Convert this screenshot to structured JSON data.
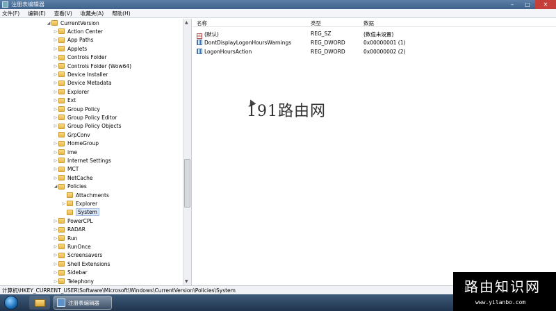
{
  "window": {
    "title": "注册表编辑器",
    "minimize": "–",
    "maximize": "□",
    "close": "✕"
  },
  "menu": [
    "文件(F)",
    "编辑(E)",
    "查看(V)",
    "收藏夹(A)",
    "帮助(H)"
  ],
  "tree": {
    "root": "CurrentVersion",
    "items": [
      {
        "label": "Action Center",
        "level": 1,
        "expander": "▷"
      },
      {
        "label": "App Paths",
        "level": 1,
        "expander": "▷"
      },
      {
        "label": "Applets",
        "level": 1,
        "expander": "▷"
      },
      {
        "label": "Controls Folder",
        "level": 1,
        "expander": "▷"
      },
      {
        "label": "Controls Folder (Wow64)",
        "level": 1,
        "expander": "▷"
      },
      {
        "label": "Device Installer",
        "level": 1,
        "expander": "▷"
      },
      {
        "label": "Device Metadata",
        "level": 1,
        "expander": "▷"
      },
      {
        "label": "Explorer",
        "level": 1,
        "expander": "▷"
      },
      {
        "label": "Ext",
        "level": 1,
        "expander": "▷"
      },
      {
        "label": "Group Policy",
        "level": 1,
        "expander": "▷"
      },
      {
        "label": "Group Policy Editor",
        "level": 1,
        "expander": "▷"
      },
      {
        "label": "Group Policy Objects",
        "level": 1,
        "expander": "▷"
      },
      {
        "label": "GrpConv",
        "level": 1,
        "expander": ""
      },
      {
        "label": "HomeGroup",
        "level": 1,
        "expander": "▷"
      },
      {
        "label": "ime",
        "level": 1,
        "expander": "▷"
      },
      {
        "label": "Internet Settings",
        "level": 1,
        "expander": "▷"
      },
      {
        "label": "MCT",
        "level": 1,
        "expander": "▷"
      },
      {
        "label": "NetCache",
        "level": 1,
        "expander": "▷"
      },
      {
        "label": "Policies",
        "level": 1,
        "expander": "◢"
      },
      {
        "label": "Attachments",
        "level": 2,
        "expander": ""
      },
      {
        "label": "Explorer",
        "level": 2,
        "expander": "▷"
      },
      {
        "label": "System",
        "level": 2,
        "expander": "",
        "selected": true
      },
      {
        "label": "PowerCPL",
        "level": 1,
        "expander": "▷"
      },
      {
        "label": "RADAR",
        "level": 1,
        "expander": "▷"
      },
      {
        "label": "Run",
        "level": 1,
        "expander": "▷"
      },
      {
        "label": "RunOnce",
        "level": 1,
        "expander": "▷"
      },
      {
        "label": "Screensavers",
        "level": 1,
        "expander": "▷"
      },
      {
        "label": "Shell Extensions",
        "level": 1,
        "expander": "▷"
      },
      {
        "label": "Sidebar",
        "level": 1,
        "expander": "▷"
      },
      {
        "label": "Telephony",
        "level": 1,
        "expander": "▷"
      }
    ]
  },
  "list": {
    "headers": {
      "name": "名称",
      "type": "类型",
      "data": "数据"
    },
    "rows": [
      {
        "icon": "string-value-icon",
        "name": "(默认)",
        "type": "REG_SZ",
        "data": "(数值未设置)"
      },
      {
        "icon": "dword-value-icon",
        "name": "DontDisplayLogonHoursWarnings",
        "type": "REG_DWORD",
        "data": "0x00000001 (1)"
      },
      {
        "icon": "dword-value-icon",
        "name": "LogonHoursAction",
        "type": "REG_DWORD",
        "data": "0x00000002 (2)"
      }
    ]
  },
  "overlay_watermark": "191路由网",
  "status_path": "计算机\\HKEY_CURRENT_USER\\Software\\Microsoft\\Windows\\CurrentVersion\\Policies\\System",
  "taskbar": {
    "active_task": "注册表编辑器"
  },
  "brand": {
    "name": "路由知识网",
    "url": "www.yilanbo.com"
  }
}
